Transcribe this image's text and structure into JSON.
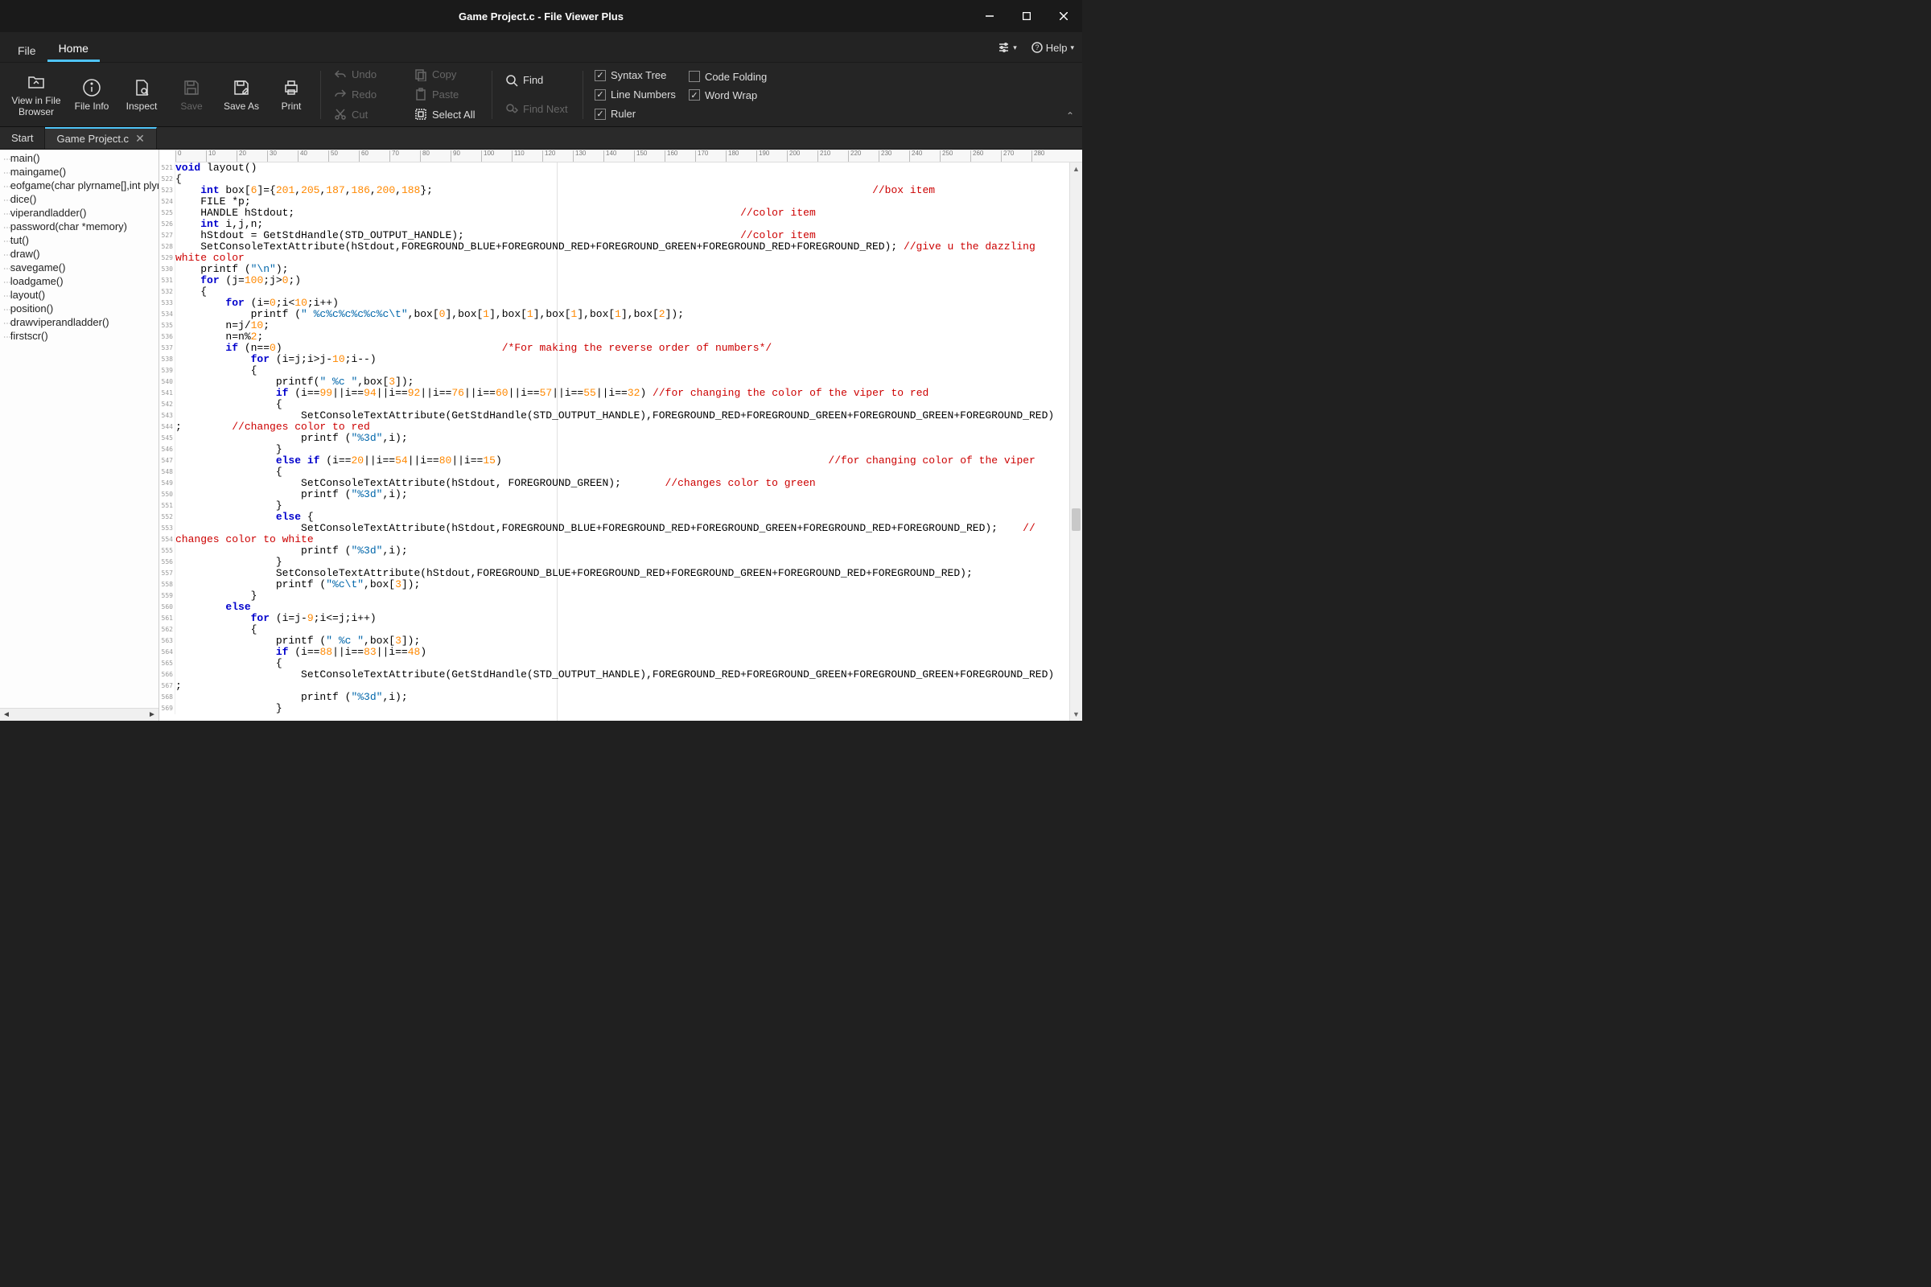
{
  "window": {
    "title": "Game Project.c - File Viewer Plus"
  },
  "menubar": {
    "file": "File",
    "home": "Home",
    "help": "Help"
  },
  "ribbon": {
    "view_in_browser": "View in File\nBrowser",
    "file_info": "File Info",
    "inspect": "Inspect",
    "save": "Save",
    "save_as": "Save As",
    "print": "Print",
    "undo": "Undo",
    "redo": "Redo",
    "cut": "Cut",
    "copy": "Copy",
    "paste": "Paste",
    "select_all": "Select All",
    "find": "Find",
    "find_next": "Find Next",
    "syntax_tree": "Syntax Tree",
    "line_numbers": "Line Numbers",
    "ruler": "Ruler",
    "code_folding": "Code Folding",
    "word_wrap": "Word Wrap",
    "checks": {
      "syntax_tree": true,
      "line_numbers": true,
      "ruler": true,
      "code_folding": false,
      "word_wrap": true
    }
  },
  "tabs": {
    "start": "Start",
    "file": "Game Project.c"
  },
  "sidetree": [
    "main()",
    "maingame()",
    "eofgame(char plyrname[],int plyr)",
    "dice()",
    "viperandladder()",
    "password(char *memory)",
    "tut()",
    "draw()",
    "savegame()",
    "loadgame()",
    "layout()",
    "position()",
    "drawviperandladder()",
    "firstscr()"
  ],
  "ruler_ticks": [
    "0",
    "10",
    "20",
    "30",
    "40",
    "50",
    "60",
    "70",
    "80",
    "90",
    "100",
    "110",
    "120",
    "130",
    "140",
    "150",
    "160",
    "170",
    "180",
    "190",
    "200",
    "210",
    "220",
    "230",
    "240",
    "250",
    "260",
    "270",
    "280"
  ],
  "gutter_start": 521,
  "gutter_count": 49,
  "code_html": "<span class='kw'>void</span> layout()\n{\n    <span class='kw'>int</span> box[<span class='num'>6</span>]={<span class='num'>201</span>,<span class='num'>205</span>,<span class='num'>187</span>,<span class='num'>186</span>,<span class='num'>200</span>,<span class='num'>188</span>};                                                                      <span class='cmt'>//box item</span>\n    FILE *p;\n    HANDLE hStdout;                                                                       <span class='cmt'>//color item</span>\n    <span class='kw'>int</span> i,j,n;\n    hStdout = GetStdHandle(STD_OUTPUT_HANDLE);                                            <span class='cmt'>//color item</span>\n    SetConsoleTextAttribute(hStdout,FOREGROUND_BLUE+FOREGROUND_RED+FOREGROUND_GREEN+FOREGROUND_RED+FOREGROUND_RED); <span class='cmt'>//give u the dazzling</span>\n<span class='cmt'>white color</span>\n    printf (<span class='str'>\"\\n\"</span>);\n    <span class='kw'>for</span> (j=<span class='num'>100</span>;j><span class='num'>0</span>;)\n    {\n        <span class='kw'>for</span> (i=<span class='num'>0</span>;i<<span class='num'>10</span>;i++)\n            printf (<span class='str'>\" %c%c%c%c%c%c\\t\"</span>,box[<span class='num'>0</span>],box[<span class='num'>1</span>],box[<span class='num'>1</span>],box[<span class='num'>1</span>],box[<span class='num'>1</span>],box[<span class='num'>2</span>]);\n        n=j/<span class='num'>10</span>;\n        n=n%<span class='num'>2</span>;\n        <span class='kw'>if</span> (n==<span class='num'>0</span>)                                   <span class='cmt'>/*For making the reverse order of numbers*/</span>\n            <span class='kw'>for</span> (i=j;i>j-<span class='num'>10</span>;i--)\n            {\n                printf(<span class='str'>\" %c \"</span>,box[<span class='num'>3</span>]);\n                <span class='kw'>if</span> (i==<span class='num'>99</span>||i==<span class='num'>94</span>||i==<span class='num'>92</span>||i==<span class='num'>76</span>||i==<span class='num'>60</span>||i==<span class='num'>57</span>||i==<span class='num'>55</span>||i==<span class='num'>32</span>) <span class='cmt'>//for changing the color of the viper to red</span>\n                {\n                    SetConsoleTextAttribute(GetStdHandle(STD_OUTPUT_HANDLE),FOREGROUND_RED+FOREGROUND_GREEN+FOREGROUND_GREEN+FOREGROUND_RED)\n;        <span class='cmt'>//changes color to red</span>\n                    printf (<span class='str'>\"%3d\"</span>,i);\n                }\n                <span class='kw'>else if</span> (i==<span class='num'>20</span>||i==<span class='num'>54</span>||i==<span class='num'>80</span>||i==<span class='num'>15</span>)                                                    <span class='cmt'>//for changing color of the viper</span>\n                {\n                    SetConsoleTextAttribute(hStdout, FOREGROUND_GREEN);       <span class='cmt'>//changes color to green</span>\n                    printf (<span class='str'>\"%3d\"</span>,i);\n                }\n                <span class='kw'>else</span> {\n                    SetConsoleTextAttribute(hStdout,FOREGROUND_BLUE+FOREGROUND_RED+FOREGROUND_GREEN+FOREGROUND_RED+FOREGROUND_RED);    <span class='cmt'>//</span>\n<span class='cmt'>changes color to white</span>\n                    printf (<span class='str'>\"%3d\"</span>,i);\n                }\n                SetConsoleTextAttribute(hStdout,FOREGROUND_BLUE+FOREGROUND_RED+FOREGROUND_GREEN+FOREGROUND_RED+FOREGROUND_RED);\n                printf (<span class='str'>\"%c\\t\"</span>,box[<span class='num'>3</span>]);\n            }\n        <span class='kw'>else</span>\n            <span class='kw'>for</span> (i=j-<span class='num'>9</span>;i<=j;i++)\n            {\n                printf (<span class='str'>\" %c \"</span>,box[<span class='num'>3</span>]);\n                <span class='kw'>if</span> (i==<span class='num'>88</span>||i==<span class='num'>83</span>||i==<span class='num'>48</span>)\n                {\n                    SetConsoleTextAttribute(GetStdHandle(STD_OUTPUT_HANDLE),FOREGROUND_RED+FOREGROUND_GREEN+FOREGROUND_GREEN+FOREGROUND_RED)\n;\n                    printf (<span class='str'>\"%3d\"</span>,i);\n                }"
}
